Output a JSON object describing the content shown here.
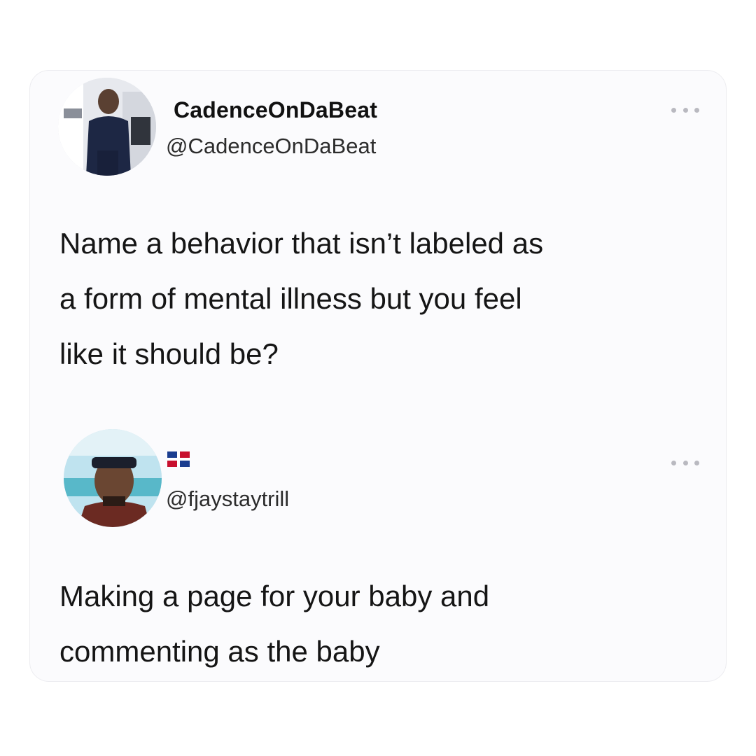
{
  "tweet": {
    "display_name": "CadenceOnDaBeat",
    "handle": "@CadenceOnDaBeat",
    "text": "Name a behavior that isn’t labeled as\na form of mental illness but you feel\nlike it should be?",
    "avatar_icon": "profile-photo",
    "more_icon": "more-options-icon"
  },
  "reply": {
    "display_name_flag": "dominican-republic-flag-icon",
    "handle": "@fjaystaytrill",
    "text": "Making a page for your baby and\ncommenting as the baby",
    "avatar_icon": "profile-photo",
    "more_icon": "more-options-icon"
  },
  "colors": {
    "card_background": "#fbfbfd",
    "text_primary": "#151515",
    "more_dots": "#b9b9c0"
  }
}
